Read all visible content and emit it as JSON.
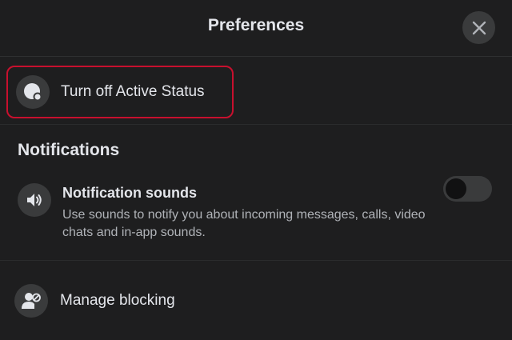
{
  "header": {
    "title": "Preferences",
    "close_icon": "close-icon"
  },
  "active_status": {
    "label": "Turn off Active Status",
    "icon": "active-status-icon",
    "highlight_color": "#c8102e"
  },
  "notifications": {
    "section_title": "Notifications",
    "sounds": {
      "title": "Notification sounds",
      "description": "Use sounds to notify you about incoming messages, calls, video chats and in-app sounds.",
      "icon": "speaker-icon",
      "enabled": false
    }
  },
  "blocking": {
    "label": "Manage blocking",
    "icon": "block-user-icon"
  }
}
